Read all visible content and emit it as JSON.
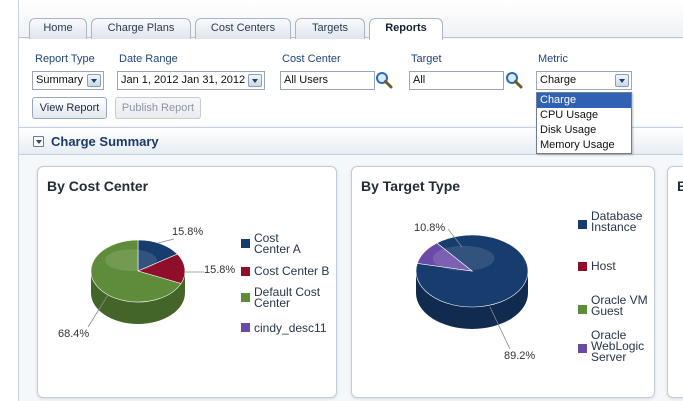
{
  "tabs": [
    {
      "label": "Home"
    },
    {
      "label": "Charge Plans"
    },
    {
      "label": "Cost Centers"
    },
    {
      "label": "Targets"
    },
    {
      "label": "Reports"
    }
  ],
  "filters": {
    "report_type_label": "Report Type",
    "report_type_value": "Summary",
    "date_range_label": "Date Range",
    "date_range_value": "Jan 1, 2012 Jan 31, 2012",
    "cost_center_label": "Cost Center",
    "cost_center_value": "All Users",
    "target_label": "Target",
    "target_value": "All",
    "metric_label": "Metric",
    "metric_value": "Charge"
  },
  "buttons": {
    "view_report": "View Report",
    "publish_report": "Publish Report"
  },
  "metric_options": [
    "Charge",
    "CPU Usage",
    "Disk Usage",
    "Memory Usage"
  ],
  "summary": {
    "title": "Charge Summary"
  },
  "panels": {
    "cost_center_title": "By Cost Center",
    "target_type_title": "By Target Type",
    "third_title_initial": "B"
  },
  "chart_data": [
    {
      "type": "pie",
      "title": "By Cost Center",
      "categories": [
        "Cost Center A",
        "Cost Center B",
        "Default Cost Center",
        "cindy_desc11"
      ],
      "values": [
        15.8,
        15.8,
        68.4,
        0
      ],
      "data_labels": [
        "15.8%",
        "15.8%",
        "68.4%"
      ],
      "colors": [
        "#173c6e",
        "#8f0f2a",
        "#5f8c3a",
        "#6a4aa8"
      ],
      "legend_placement": "right"
    },
    {
      "type": "pie",
      "title": "By Target Type",
      "categories": [
        "Database Instance",
        "Host",
        "Oracle VM Guest",
        "Oracle WebLogic Server"
      ],
      "values": [
        89.2,
        0,
        0,
        10.8
      ],
      "data_labels": [
        "10.8%",
        "89.2%"
      ],
      "colors": [
        "#173c6e",
        "#8f0f2a",
        "#5f8c3a",
        "#6a4aa8"
      ],
      "legend_placement": "right"
    }
  ],
  "legend1": {
    "a": "Cost Center A",
    "b": "Cost Center B",
    "c": "Default Cost Center",
    "d": "cindy_desc11"
  },
  "legend2": {
    "a": "Database Instance",
    "b": "Host",
    "c": "Oracle VM Guest",
    "d": "Oracle WebLogic Server"
  }
}
